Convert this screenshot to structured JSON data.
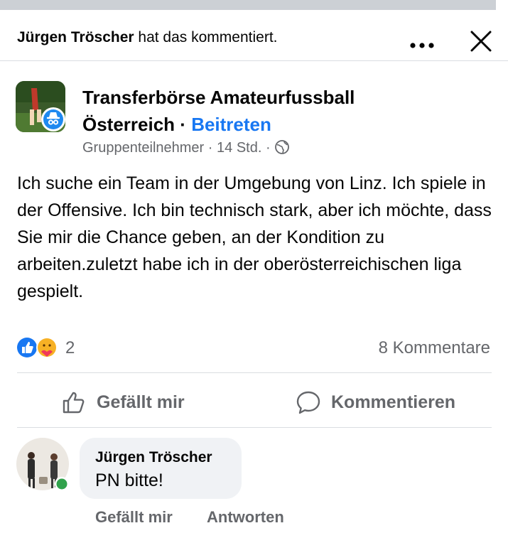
{
  "activity": {
    "actor": "Jürgen Tröscher",
    "text": " hat das kommentiert."
  },
  "post": {
    "group_name_line1": "Transferbörse Amateurfussball",
    "group_name_line2": "Österreich",
    "separator": " · ",
    "join_label": "Beitreten",
    "role": "Gruppenteilnehmer",
    "time": "14 Std.",
    "dot": "·",
    "body": "Ich suche ein Team in der Umgebung von Linz. Ich spiele in der Offensive. Ich bin technisch stark, aber ich möchte, dass Sie mir die Chance geben, an der Kondition zu arbeiten.zuletzt habe ich in der oberösterreichischen liga gespielt.",
    "reaction_count": "2",
    "comment_count": "8 Kommentare"
  },
  "actions": {
    "like_label": "Gefällt mir",
    "comment_label": "Kommentieren"
  },
  "comment": {
    "author": "Jürgen Tröscher",
    "text": "PN bitte!",
    "like_label": "Gefällt mir",
    "reply_label": "Antworten"
  },
  "colors": {
    "link_blue": "#1877f2",
    "secondary_text": "#65676b",
    "online_green": "#31a24c",
    "bubble_bg": "#f0f2f5"
  },
  "icons": [
    "more-icon",
    "close-icon",
    "anonymous-badge-icon",
    "globe-icon",
    "like-reaction-icon",
    "care-reaction-icon",
    "thumbs-up-icon",
    "comment-icon"
  ]
}
